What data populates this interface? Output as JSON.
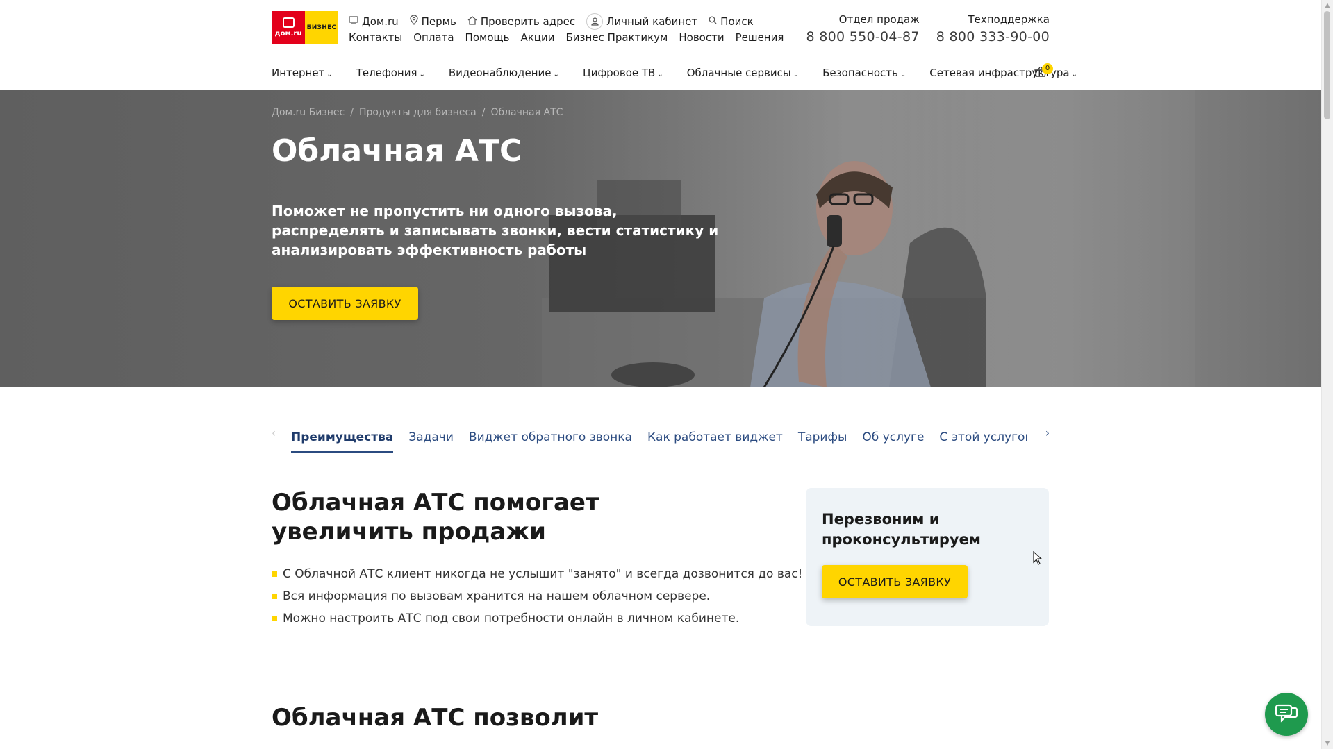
{
  "logo": {
    "left": "дом.ru",
    "right": "БИЗНЕС"
  },
  "header": {
    "top_links": [
      {
        "icon": "monitor-icon",
        "label": "Дом.ru"
      },
      {
        "icon": "location-icon",
        "label": "Пермь"
      },
      {
        "icon": "house-icon",
        "label": "Проверить адрес"
      },
      {
        "icon": "user-icon",
        "label": "Личный кабинет"
      },
      {
        "icon": "search-icon",
        "label": "Поиск"
      }
    ],
    "second_links": [
      "Контакты",
      "Оплата",
      "Помощь",
      "Акции",
      "Бизнес Практикум",
      "Новости",
      "Решения"
    ],
    "phones": [
      {
        "label": "Отдел продаж",
        "number": "8 800 550-04-87"
      },
      {
        "label": "Техподдержка",
        "number": "8 800 333-90-00"
      }
    ],
    "menu": [
      "Интернет",
      "Телефония",
      "Видеонаблюдение",
      "Цифровое ТВ",
      "Облачные сервисы",
      "Безопасность",
      "Сетевая инфраструктура"
    ],
    "cart_count": "0"
  },
  "hero": {
    "breadcrumb": [
      "Дом.ru Бизнес",
      "Продукты для бизнеса",
      "Облачная АТС"
    ],
    "title": "Облачная АТС",
    "subtitle": "Поможет не пропустить ни одного вызова, распределять и записывать звонки, вести статистику и анализировать эффективность работы",
    "cta": "ОСТАВИТЬ ЗАЯВКУ"
  },
  "tabs": [
    "Преимущества",
    "Задачи",
    "Виджет обратного звонка",
    "Как работает виджет",
    "Тарифы",
    "Об услуге",
    "С этой услугой обычно покупают"
  ],
  "section1": {
    "title": "Облачная АТС помогает увеличить продажи",
    "bullets": [
      "С Облачной АТС клиент никогда не услышит \"занято\" и всегда дозвонится до вас!",
      "Вся информация по вызовам хранится на нашем облачном сервере.",
      "Можно настроить АТС под свои потребности онлайн в личном кабинете."
    ]
  },
  "card": {
    "title": "Перезвоним и проконсультируем",
    "cta": "ОСТАВИТЬ ЗАЯВКУ"
  },
  "section2": {
    "title": "Облачная АТС позволит"
  },
  "colors": {
    "accent": "#ffd500",
    "brand_red": "#e3001b",
    "link": "#2b4b80",
    "chat": "#1f9a4e"
  }
}
